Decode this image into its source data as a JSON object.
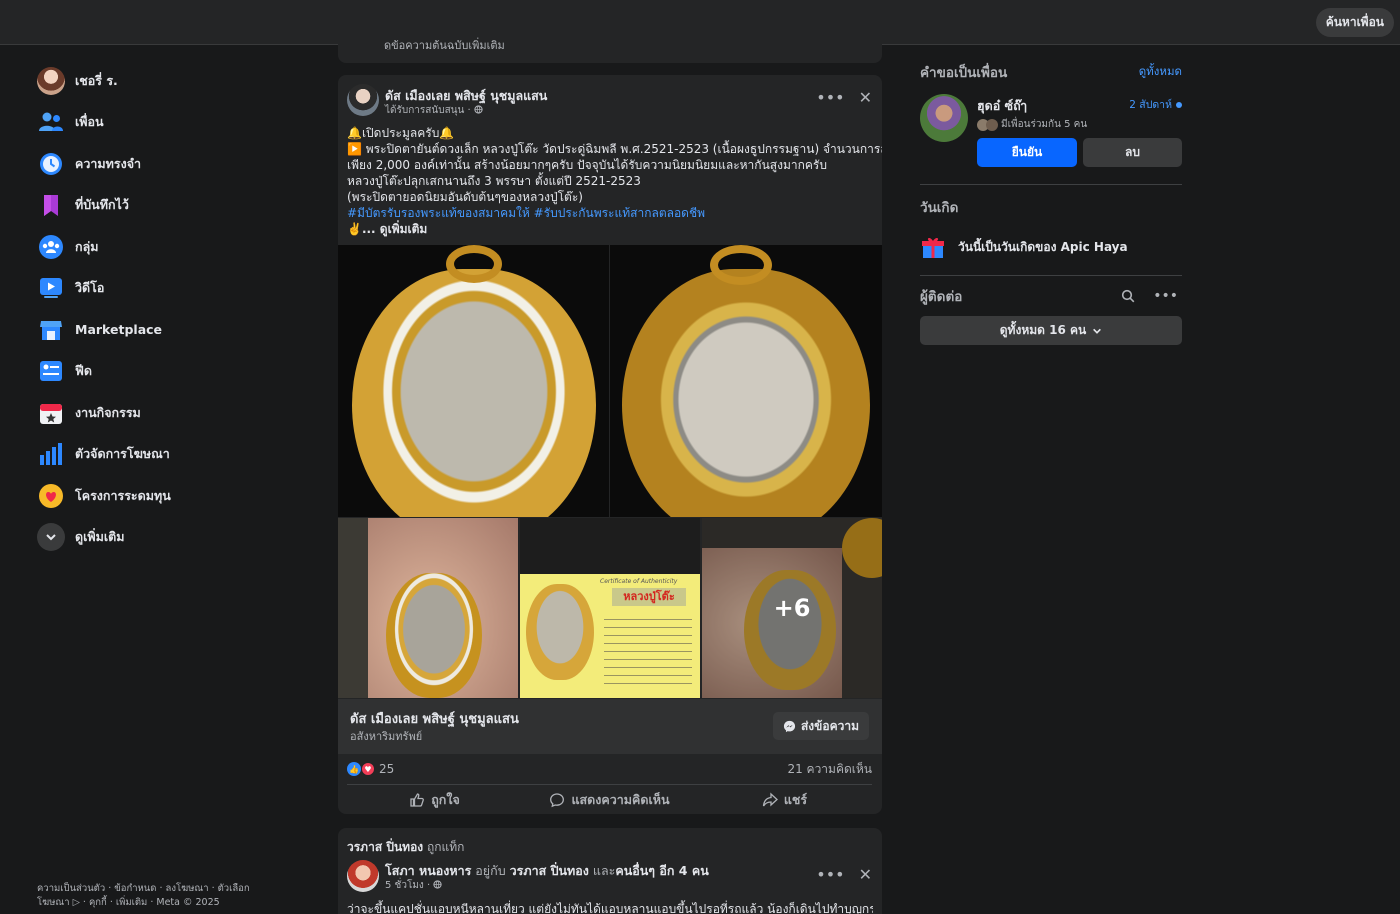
{
  "topbar": {
    "find_friends": "ค้นหาเพื่อน",
    "tabs": [
      "home-icon",
      "friends-icon",
      "profile-circle-icon"
    ]
  },
  "left_nav": {
    "items": [
      {
        "label": "เชอรี่ ร.",
        "icon": "avatar"
      },
      {
        "label": "เพื่อน",
        "icon": "friends-icon"
      },
      {
        "label": "ความทรงจำ",
        "icon": "clock-icon"
      },
      {
        "label": "ที่บันทึกไว้",
        "icon": "bookmark-icon"
      },
      {
        "label": "กลุ่ม",
        "icon": "groups-icon"
      },
      {
        "label": "วิดีโอ",
        "icon": "video-icon"
      },
      {
        "label": "Marketplace",
        "icon": "marketplace-icon"
      },
      {
        "label": "ฟีด",
        "icon": "feed-icon"
      },
      {
        "label": "งานกิจกรรม",
        "icon": "calendar-icon"
      },
      {
        "label": "ตัวจัดการโฆษณา",
        "icon": "ads-chart-icon"
      },
      {
        "label": "โครงการระดมทุน",
        "icon": "fundraiser-heart-icon"
      },
      {
        "label": "ดูเพิ่มเติม",
        "icon": "chevron-down-icon"
      }
    ],
    "footer_line1": "ความเป็นส่วนตัว · ข้อกำหนด · ลงโฆษณา · ตัวเลือก",
    "footer_line2": "โฆษณา ▷ · คุกกี้ · เพิ่มเติม · Meta © 2025"
  },
  "prev_post": {
    "text": "ดูข้อความต้นฉบับเพิ่มเติม"
  },
  "post": {
    "author": "ดัส เมืองเลย พสิษฐ์ นุชมูลแสน",
    "meta": "ได้รับการสนับสนุน ·",
    "text_lines": [
      "🔔เปิดประมูลครับ🔔",
      "▶️ พระปิดตายันต์ดวงเล็ก หลวงปู่โต๊ะ วัดประดู่ฉิมพลี พ.ศ.2521-2523 (เนื้อผงธูปกรรมฐาน) จำนวนการสร้าง",
      "เพียง 2,000 องค์เท่านั้น สร้างน้อยมากๆครับ ปัจจุบันได้รับความนิยมนิยมและหากันสูงมากครับ",
      "หลวงปู่โต๊ะปลุกเสกนานถึง 3 พรรษา ตั้งแต่ปี 2521-2523",
      "(พระปิดตายอดนิยมอันดับต้นๆของหลวงปู่โต๊ะ)"
    ],
    "hashtags": "#มีบัตรรับรองพระแท้ของสมาคมให้ #รับประกันพระแท้สากลตลอดชีพ",
    "see_more": "✌️... ดูเพิ่มเติม",
    "more_photos": "+6",
    "page_name": "ดัส เมืองเลย พสิษฐ์ นุชมูลแสน",
    "page_category": "อสังหาริมทรัพย์",
    "send_message": "ส่งข้อความ",
    "reaction_count": "25",
    "comment_count": "21 ความคิดเห็น",
    "actions": {
      "like": "ถูกใจ",
      "comment": "แสดงความคิดเห็น",
      "share": "แชร์"
    },
    "card_title": "หลวงปู่โต๊ะ",
    "card_header": "Certificate of Authenticity"
  },
  "post2": {
    "tag_name": "วรภาส ปิ่นทอง",
    "tag_suffix": " ถูกแท็ก",
    "author": "โสภา หนองหาร",
    "with_text": " อยู่กับ ",
    "with_name": "วรภาส ปิ่นทอง",
    "and_text": " และ",
    "others": "คนอื่นๆ อีก 4 คน",
    "meta": "5 ชั่วโมง ·",
    "text": "ว่าจะขึ้นแคปชั่นแอบหนีหลานเที่ยว แต่ยังไม่ทันได้แอบหลานแอบขึ้นไปรอที่รถแล้ว น้องก็เดินไปทำบุญกระดูก"
  },
  "right": {
    "requests_title": "คำขอเป็นเพื่อน",
    "see_all": "ดูทั้งหมด",
    "request": {
      "name": "ฮุดอ๋ ซ์ถ๊ๅ",
      "time": "2 สัปดาห์",
      "mutual": "มีเพื่อนร่วมกัน 5 คน",
      "confirm": "ยืนยัน",
      "delete": "ลบ"
    },
    "birthdays_title": "วันเกิด",
    "birthday_text": "วันนี้เป็นวันเกิดของ Apic Haya",
    "contacts_title": "ผู้ติดต่อ",
    "see_all_contacts": "ดูทั้งหมด 16 คน"
  }
}
